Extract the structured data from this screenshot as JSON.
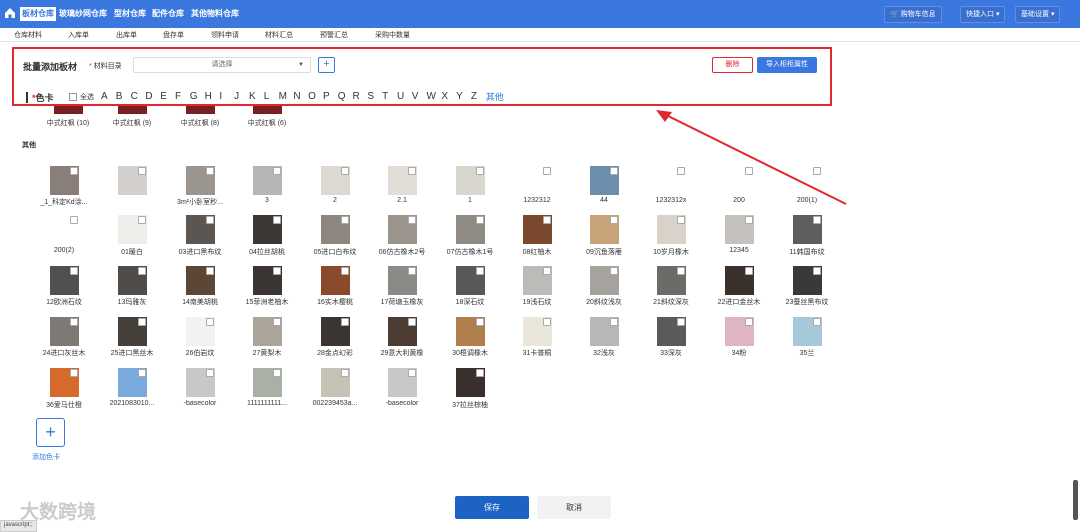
{
  "topbar": {
    "tabs": [
      "板材仓库",
      "玻璃纱网仓库",
      "型材仓库",
      "配件仓库",
      "其他物料仓库"
    ],
    "cart": "购物车信息",
    "quick": "快捷入口 ▾",
    "settings": "基础设置 ▾"
  },
  "subnav": [
    "仓库材料",
    "入库单",
    "出库单",
    "盘存单",
    "领料申请",
    "材料汇总",
    "预警汇总",
    "采购中数量"
  ],
  "panel": {
    "title": "批量添加板材",
    "catalog_label": "材料目录",
    "select_placeholder": "请选择",
    "plus": "+",
    "delete": "删除",
    "import": "导入柜柜属性",
    "color_label": "色卡",
    "select_all": "全选",
    "letters": [
      "A",
      "B",
      "C",
      "D",
      "E",
      "F",
      "G",
      "H",
      "I",
      "J",
      "K",
      "L",
      "M",
      "N",
      "O",
      "P",
      "Q",
      "R",
      "S",
      "T",
      "U",
      "V",
      "W",
      "X",
      "Y",
      "Z"
    ],
    "other": "其他"
  },
  "top_row": [
    "中式红枫 (10)",
    "中式红枫 (9)",
    "中式红枫 (8)",
    "中式红枫 (6)"
  ],
  "section_other": "其他",
  "rows": [
    [
      "_1_科定Kd涂...",
      "",
      "3m²小卧室秒...",
      "3",
      "2",
      "2.1",
      "1",
      "1232312",
      "44",
      "1232312x",
      "200",
      "200(1)"
    ],
    [
      "200(2)",
      "01暖白",
      "03进口黑布纹",
      "04拉丝胡桃",
      "05进口白布纹",
      "06仿古橡木2号",
      "07仿古橡木1号",
      "08红柚木",
      "09沉鱼落雁",
      "10岁月橡木",
      "12345",
      "11韩国布纹"
    ],
    [
      "12欧洲石纹",
      "13玛雅灰",
      "14南美胡桃",
      "15菲洲老柚木",
      "16实木樱桃",
      "17荷塘玉橡灰",
      "18深石纹",
      "19浅石纹",
      "20斜纹浅灰",
      "21斜纹深灰",
      "22进口金丝木",
      "23蚕丝黑布纹"
    ],
    [
      "24进口灰丝木",
      "25进口黑丝木",
      "26伯岩纹",
      "27黄梨木",
      "28金点幻彩",
      "29意大利黄橡",
      "30梧调橡木",
      "31卡普桐",
      "32浅灰",
      "33深灰",
      "34粉",
      "35兰"
    ],
    [
      "36爱马仕橙",
      "2021083010...",
      "-basecolor",
      "1111111111...",
      "002239453a...",
      "-basecolor",
      "37拉丝棕柚"
    ]
  ],
  "add_color": "添加色卡",
  "save": "保存",
  "cancel": "取消",
  "status": "javascript:;",
  "watermark": "大数跨境",
  "colors": {
    "accent": "#3a78e0",
    "danger": "#e0282e",
    "save": "#1c63c4"
  }
}
